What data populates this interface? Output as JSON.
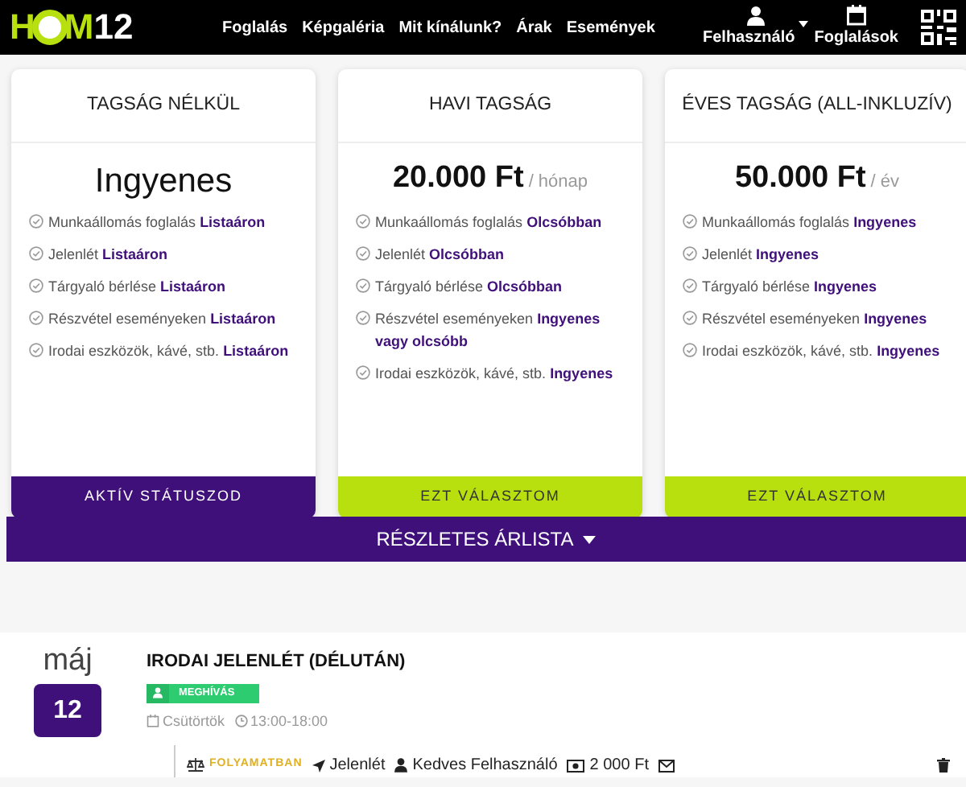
{
  "logo": {
    "left": "H",
    "right": "M",
    "number": "12"
  },
  "nav": [
    "Foglalás",
    "Képgaléria",
    "Mit kínálunk?",
    "Árak",
    "Események"
  ],
  "user_menu": {
    "label": "Felhasználó"
  },
  "bookings_link": {
    "label": "Foglalások"
  },
  "plans": [
    {
      "title": "TAGSÁG NÉLKÜL",
      "price": "Ingyenes",
      "features": [
        "Munkaállomás foglalás **Listaáron**",
        "Jelenlét **Listaáron**",
        "Tárgyaló bérlése **Listaáron**",
        "Részvétel eseményeken **Listaáron**",
        "Irodai eszközök, kávé, stb. **Listaáron**"
      ],
      "button": "AKTÍV STÁTUSZOD",
      "active": true
    },
    {
      "title": "HAVI TAGSÁG",
      "price": "20.000 Ft",
      "period": "/ hónap",
      "features": [
        "Munkaállomás foglalás **Olcsóbban**",
        "Jelenlét **Olcsóbban**",
        "Tárgyaló bérlése **Olcsóbban**",
        "Részvétel eseményeken **Ingyenes vagy olcsóbb**",
        "Irodai eszközök, kávé, stb. **Ingyenes**"
      ],
      "button": "EZT VÁLASZTOM",
      "active": false
    },
    {
      "title": "ÉVES TAGSÁG (ALL-INKLUZÍV)",
      "price": "50.000 Ft",
      "period": "/ év",
      "features": [
        "Munkaállomás foglalás **Ingyenes**",
        "Jelenlét **Ingyenes**",
        "Tárgyaló bérlése **Ingyenes**",
        "Részvétel eseményeken **Ingyenes**",
        "Irodai eszközök, kávé, stb. **Ingyenes**"
      ],
      "button": "EZT VÁLASZTOM",
      "active": false
    }
  ],
  "price_list_button": "RÉSZLETES ÁRLISTA",
  "event": {
    "month": "máj",
    "day": "12",
    "title": "IRODAI JELENLÉT (DÉLUTÁN)",
    "badge": "MEGHÍVÁS",
    "weekday": "Csütörtök",
    "time": "13:00-18:00",
    "entry": {
      "status": "FOLYAMATBAN",
      "type": "Jelenlét",
      "user": "Kedves Felhasználó",
      "price": "2 000 Ft"
    }
  }
}
